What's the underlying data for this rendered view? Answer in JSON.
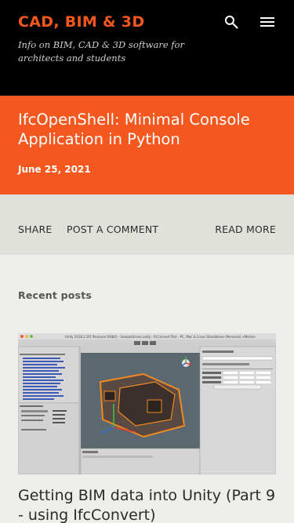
{
  "site": {
    "title": "CAD, BIM & 3D",
    "description": "Info on BIM, CAD & 3D software for architects and students"
  },
  "header": {
    "search_icon": "search-icon",
    "menu_icon": "menu-icon"
  },
  "post": {
    "title": "IfcOpenShell: Minimal Console Application in Python",
    "date": "June 25, 2021"
  },
  "actions": {
    "share": "SHARE",
    "comment": "POST A COMMENT",
    "read_more": "READ MORE"
  },
  "recent": {
    "heading": "Recent posts",
    "items": [
      {
        "title": "Getting BIM data into Unity (Part 9 - using IfcConvert)",
        "thumbnail": {
          "window_title": "Unity 2018.2.3f1 Personal (64bit) - SampleScene.unity - IfcConvert-Test - PC, Mac & Linux Standalone (Personal) <Metal>"
        }
      }
    ]
  },
  "colors": {
    "accent": "#f4581e",
    "header_bg": "#000000",
    "actions_bg": "#e1e1dc",
    "page_bg": "#eeeeea"
  }
}
